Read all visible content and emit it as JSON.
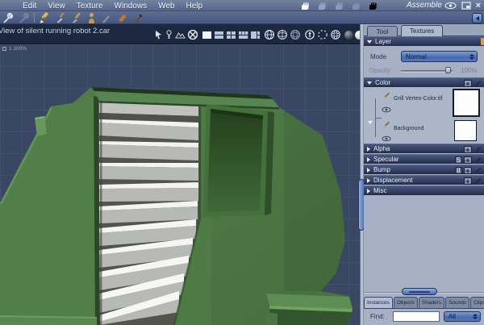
{
  "menubar": {
    "items": [
      "Edit",
      "View",
      "Texture",
      "Windows",
      "Web",
      "Help"
    ],
    "room_label": "Assemble",
    "close_glyph": "×"
  },
  "viewport": {
    "title": "View of silent running robot 2.car",
    "zoom_indicator": "1 100%"
  },
  "panel": {
    "tabs": {
      "tool": "Tool",
      "textures": "Textures"
    },
    "layer": {
      "title": "Layer",
      "mode_label": "Mode",
      "mode_value": "Normal",
      "opacity_label": "Opacity",
      "opacity_value": "100%"
    },
    "color": {
      "title": "Color",
      "layers": [
        {
          "name": "Grill Vertex-Color.tif"
        },
        {
          "name": "Background"
        }
      ]
    },
    "channels": [
      {
        "label": "Alpha"
      },
      {
        "label": "Specular",
        "badge": "S"
      },
      {
        "label": "Bump",
        "badge": "II"
      },
      {
        "label": "Displacement"
      },
      {
        "label": "Misc"
      }
    ],
    "bottom_tabs": [
      "Instances",
      "Objects",
      "Shaders",
      "Sounds",
      "Clips"
    ],
    "find": {
      "label": "Find:",
      "value": "",
      "filter_value": "All"
    }
  },
  "colors": {
    "accent_blue": "#5b7cba",
    "panel_bg": "#a6b1c5",
    "header_bar": "#2d3a5c",
    "viewport_bg": "#3a4762",
    "body_green": "#4e7a45",
    "slat_white": "#f3f3f0",
    "swatch_color": "#fdfdfd"
  }
}
